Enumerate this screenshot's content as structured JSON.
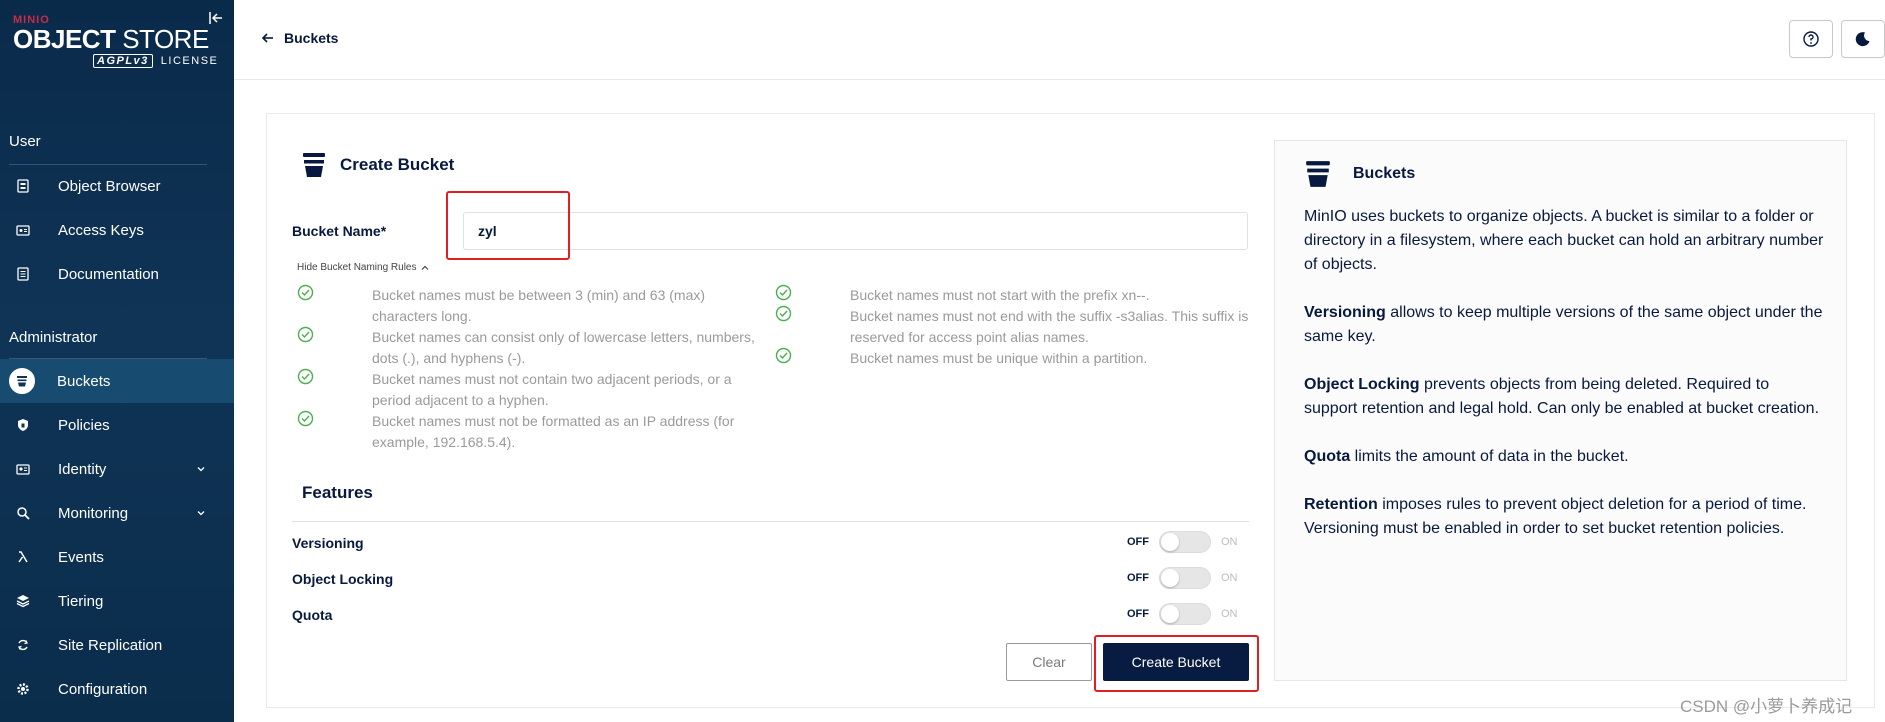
{
  "brand": {
    "minio": "MINIO",
    "object": "OBJECT",
    "store": "STORE",
    "agpl": "AGPLv3",
    "license": "LICENSE"
  },
  "sidebar": {
    "user_section": "User",
    "user_items": [
      {
        "label": "Object Browser",
        "icon": "object-browser-icon"
      },
      {
        "label": "Access Keys",
        "icon": "access-keys-icon"
      },
      {
        "label": "Documentation",
        "icon": "documentation-icon"
      }
    ],
    "admin_section": "Administrator",
    "admin_items": [
      {
        "label": "Buckets",
        "icon": "bucket-icon",
        "active": true
      },
      {
        "label": "Policies",
        "icon": "policies-icon"
      },
      {
        "label": "Identity",
        "icon": "identity-icon",
        "expandable": true
      },
      {
        "label": "Monitoring",
        "icon": "monitoring-icon",
        "expandable": true
      },
      {
        "label": "Events",
        "icon": "lambda-icon"
      },
      {
        "label": "Tiering",
        "icon": "tiering-icon"
      },
      {
        "label": "Site Replication",
        "icon": "replication-icon"
      },
      {
        "label": "Configuration",
        "icon": "gear-icon"
      }
    ]
  },
  "header": {
    "back_label": "Buckets"
  },
  "form": {
    "title": "Create Bucket",
    "name_label": "Bucket Name*",
    "name_value": "zyl",
    "hide_rules": "Hide Bucket Naming Rules",
    "rules_left": [
      "Bucket names must be between 3 (min) and 63 (max) characters long.",
      "Bucket names can consist only of lowercase letters, numbers, dots (.), and hyphens (-).",
      "Bucket names must not contain two adjacent periods, or a period adjacent to a hyphen.",
      "Bucket names must not be formatted as an IP address (for example, 192.168.5.4)."
    ],
    "rules_right": [
      "Bucket names must not start with the prefix xn--.",
      "Bucket names must not end with the suffix -s3alias. This suffix is reserved for access point alias names.",
      "Bucket names must be unique within a partition."
    ],
    "features_title": "Features",
    "features": [
      {
        "label": "Versioning",
        "off": "OFF",
        "on": "ON"
      },
      {
        "label": "Object Locking",
        "off": "OFF",
        "on": "ON"
      },
      {
        "label": "Quota",
        "off": "OFF",
        "on": "ON"
      }
    ],
    "clear_label": "Clear",
    "create_label": "Create Bucket"
  },
  "help": {
    "title": "Buckets",
    "intro": "MinIO uses buckets to organize objects. A bucket is similar to a folder or directory in a filesystem, where each bucket can hold an arbitrary number of objects.",
    "versioning_term": "Versioning",
    "versioning_text": " allows to keep multiple versions of the same object under the same key.",
    "locking_term": "Object Locking",
    "locking_text": " prevents objects from being deleted. Required to support retention and legal hold. Can only be enabled at bucket creation.",
    "quota_term": "Quota",
    "quota_text": " limits the amount of data in the bucket.",
    "retention_term": "Retention",
    "retention_text": " imposes rules to prevent object deletion for a period of time. Versioning must be enabled in order to set bucket retention policies."
  },
  "watermark": "CSDN @小萝卜养成记",
  "colors": {
    "sidebar": "#0f3456",
    "primary": "#081c42",
    "highlight": "#e02020",
    "check": "#4caf50"
  }
}
